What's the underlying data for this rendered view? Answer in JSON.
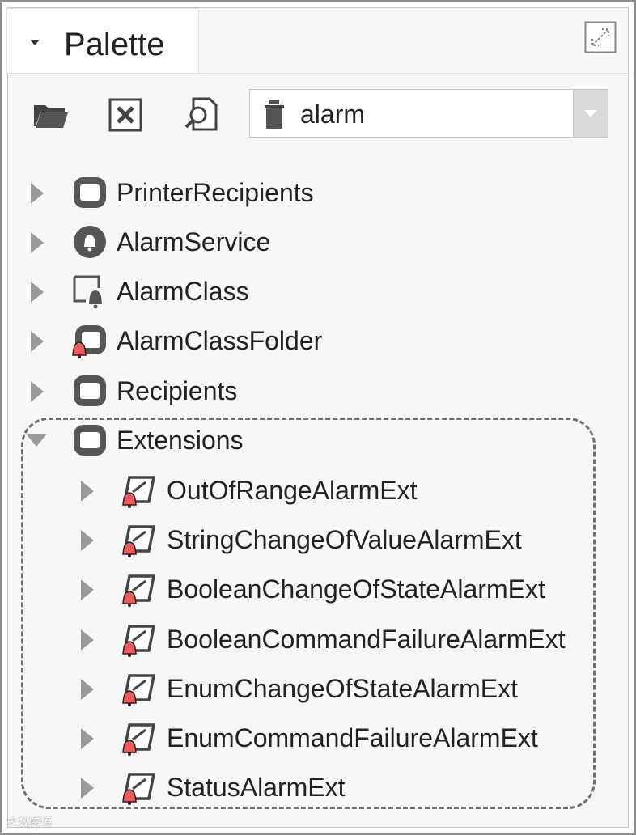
{
  "palette": {
    "title": "Palette",
    "module_selector": {
      "value": "alarm"
    }
  },
  "tree": {
    "top_items": [
      {
        "label": "PrinterRecipients",
        "icon": "folder-icon"
      },
      {
        "label": "AlarmService",
        "icon": "alarm-service-icon"
      },
      {
        "label": "AlarmClass",
        "icon": "alarm-class-icon"
      },
      {
        "label": "AlarmClassFolder",
        "icon": "alarm-folder-icon"
      },
      {
        "label": "Recipients",
        "icon": "folder-icon"
      },
      {
        "label": "Extensions",
        "icon": "folder-icon",
        "expanded": true
      }
    ],
    "extensions": [
      {
        "label": "OutOfRangeAlarmExt",
        "icon": "alarm-ext-icon"
      },
      {
        "label": "StringChangeOfValueAlarmExt",
        "icon": "alarm-ext-icon"
      },
      {
        "label": "BooleanChangeOfStateAlarmExt",
        "icon": "alarm-ext-icon"
      },
      {
        "label": "BooleanCommandFailureAlarmExt",
        "icon": "alarm-ext-icon"
      },
      {
        "label": "EnumChangeOfStateAlarmExt",
        "icon": "alarm-ext-icon"
      },
      {
        "label": "EnumCommandFailureAlarmExt",
        "icon": "alarm-ext-icon"
      },
      {
        "label": "StatusAlarmExt",
        "icon": "alarm-ext-icon"
      }
    ]
  },
  "watermark": {
    "text": "大数跨境"
  },
  "colors": {
    "bell_red": "#f25a5a",
    "icon_gray": "#555555",
    "expander": "#9a9a9a"
  }
}
